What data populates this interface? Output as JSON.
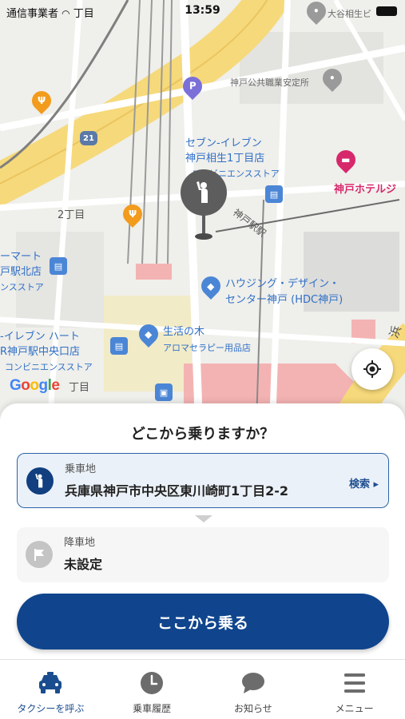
{
  "status_bar": {
    "carrier": "通信事業者",
    "network_suffix": "丁目",
    "time": "13:59"
  },
  "map": {
    "labels": {
      "seven_eleven_1": "セブン-イレブン",
      "seven_eleven_1b": "神戸相生1丁目店",
      "convenience_1": "コンビニエンスストア",
      "job_center": "神戸公共職業安定所",
      "hotel": "神戸ホテルジ",
      "ootani": "大谷相生ビ",
      "station_north": "ーマート",
      "station_north_b": "戸駅北店",
      "station_north_c": "ンスストア",
      "chome_2": "2丁目",
      "chome_1": "丁目",
      "housing_1": "ハウジング・デザイン・",
      "housing_2": "センター神戸 (HDC神戸)",
      "seikatsu": "生活の木",
      "seikatsu_b": "アロマセラピー用品店",
      "seven_heart": "-イレブン ハート",
      "seven_heart_b": "R神戸駅中央口店",
      "convenience_2": "コンビニエンスストア",
      "road_kobe": "神戸駅駅",
      "road_hama": "浜",
      "route_21": "21"
    },
    "google_logo": [
      "G",
      "o",
      "o",
      "g",
      "l",
      "e"
    ],
    "google_colors": [
      "#4285F4",
      "#EA4335",
      "#FBBC05",
      "#4285F4",
      "#34A853",
      "#EA4335"
    ]
  },
  "sheet": {
    "title": "どこから乗りますか？",
    "pickup": {
      "caption": "乗車地",
      "value": "兵庫県神戸市中央区東川崎町1丁目2-2",
      "search_label": "検索 ▸"
    },
    "dropoff": {
      "caption": "降車地",
      "value": "未設定"
    },
    "ride_button": "ここから乗る"
  },
  "tabs": [
    {
      "label": "タクシーを呼ぶ",
      "icon": "taxi-icon",
      "active": true
    },
    {
      "label": "乗車履歴",
      "icon": "clock-icon",
      "active": false
    },
    {
      "label": "お知らせ",
      "icon": "speech-bubble-icon",
      "active": false
    },
    {
      "label": "メニュー",
      "icon": "hamburger-menu-icon",
      "active": false
    }
  ],
  "colors": {
    "primary": "#10458d",
    "map_highway": "#f6d97a",
    "map_pink_zone": "#f4b3b3"
  }
}
